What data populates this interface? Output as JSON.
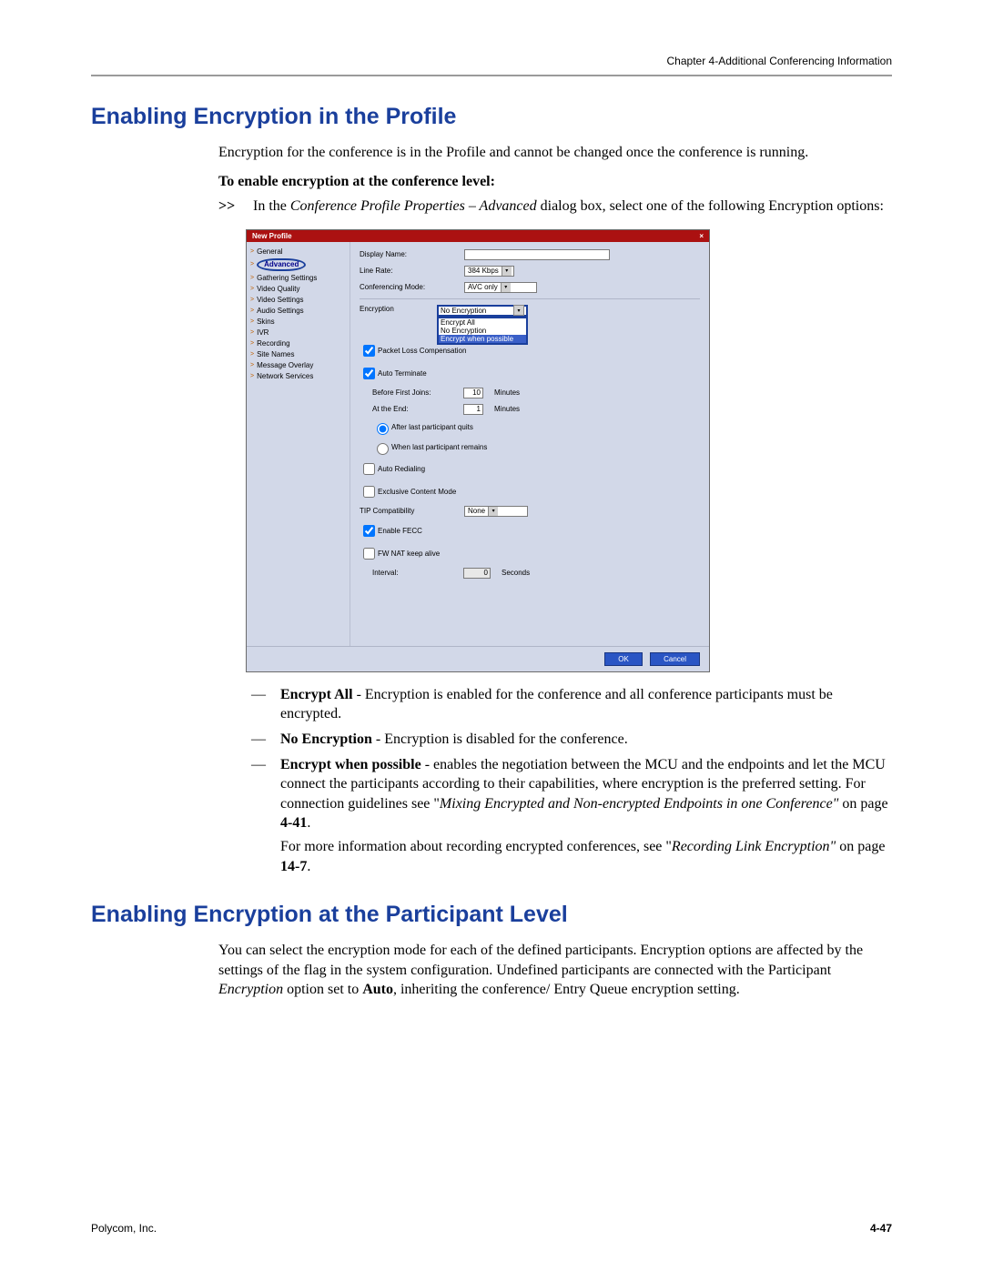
{
  "header": {
    "chapter": "Chapter 4-Additional Conferencing Information"
  },
  "section1": {
    "title": "Enabling Encryption in the Profile",
    "intro": "Encryption for the conference is in the Profile and cannot be changed once the conference is running.",
    "howto_title": "To enable encryption at the conference level:",
    "step_marker": ">>",
    "step_pre": "In the ",
    "step_em": "Conference Profile Properties – Advanced",
    "step_post": " dialog box, select one of the following Encryption options:"
  },
  "dialog": {
    "title": "New Profile",
    "close": "×",
    "nav": [
      {
        "label": "General",
        "selected": false
      },
      {
        "label": "Advanced",
        "selected": true
      },
      {
        "label": "Gathering Settings",
        "selected": false
      },
      {
        "label": "Video Quality",
        "selected": false
      },
      {
        "label": "Video Settings",
        "selected": false
      },
      {
        "label": "Audio Settings",
        "selected": false
      },
      {
        "label": "Skins",
        "selected": false
      },
      {
        "label": "IVR",
        "selected": false
      },
      {
        "label": "Recording",
        "selected": false
      },
      {
        "label": "Site Names",
        "selected": false
      },
      {
        "label": "Message Overlay",
        "selected": false
      },
      {
        "label": "Network Services",
        "selected": false
      }
    ],
    "form": {
      "display_name_label": "Display Name:",
      "display_name_value": "",
      "line_rate_label": "Line Rate:",
      "line_rate_value": "384 Kbps",
      "conf_mode_label": "Conferencing Mode:",
      "conf_mode_value": "AVC only",
      "encryption_label": "Encryption",
      "encryption_value": "No Encryption",
      "encryption_options": [
        "Encrypt All",
        "No Encryption",
        "Encrypt when possible"
      ],
      "packet_loss_label": "Packet Loss Compensation",
      "auto_terminate_label": "Auto Terminate",
      "before_first_label": "Before First Joins:",
      "before_first_value": "10",
      "before_first_unit": "Minutes",
      "at_end_label": "At the End:",
      "at_end_value": "1",
      "at_end_unit": "Minutes",
      "after_last_quits": "After last participant quits",
      "when_last_remains": "When last participant remains",
      "auto_redial": "Auto Redialing",
      "exclusive_content": "Exclusive Content Mode",
      "tip_compat_label": "TIP Compatibility",
      "tip_compat_value": "None",
      "enable_fecc": "Enable FECC",
      "fw_nat": "FW NAT keep alive",
      "interval_label": "Interval:",
      "interval_value": "0",
      "interval_unit": "Seconds"
    },
    "buttons": {
      "ok": "OK",
      "cancel": "Cancel"
    }
  },
  "options_list": [
    {
      "bold": "Encrypt All",
      "rest": " - Encryption is enabled for the conference and all conference participants must be encrypted."
    },
    {
      "bold": "No Encryption",
      "rest": " - Encryption is disabled for the conference."
    },
    {
      "bold": "Encrypt when possible",
      "rest_pre": " - enables the negotiation between the MCU and the endpoints and let the MCU connect the participants according to their capabilities, where encryption is the preferred setting. For connection guidelines see \"",
      "rest_em": "Mixing Encrypted and Non-encrypted Endpoints in one Conference\"",
      "rest_mid": " on page ",
      "rest_page": "4-41",
      "rest_dot": ".",
      "para2_pre": "For more information about recording encrypted conferences, see \"",
      "para2_em": "Recording Link Encryption\"",
      "para2_mid": " on page ",
      "para2_page": "14-7",
      "para2_dot": "."
    }
  ],
  "section2": {
    "title": "Enabling Encryption at the Participant Level",
    "intro_pre": "You can select the encryption mode for each of the defined participants. Encryption options are affected by the settings of the flag in the system configuration. Undefined participants are connected with the Participant ",
    "intro_em1": "Encryption",
    "intro_mid": " option set to ",
    "intro_bold": "Auto",
    "intro_post": ", inheriting the conference/ Entry Queue encryption setting."
  },
  "footer": {
    "left": "Polycom, Inc.",
    "right": "4-47"
  }
}
